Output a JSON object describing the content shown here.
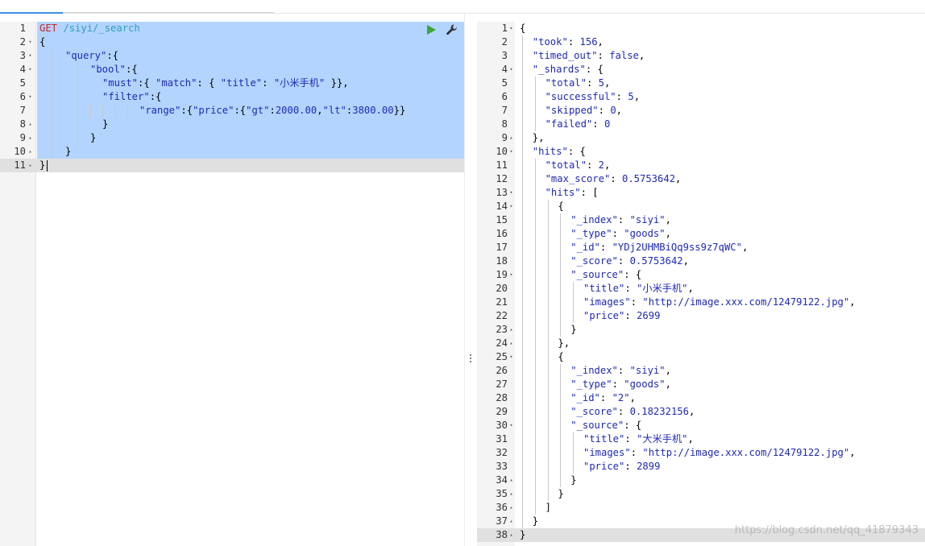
{
  "window": {
    "watermark": "https://blog.csdn.net/qq_41879343"
  },
  "request": {
    "method": "GET",
    "path": "/siyi/_search",
    "lines": [
      {
        "n": "1",
        "fold": ""
      },
      {
        "n": "2",
        "fold": "▾"
      },
      {
        "n": "3",
        "fold": "▾"
      },
      {
        "n": "4",
        "fold": "▾"
      },
      {
        "n": "5",
        "fold": ""
      },
      {
        "n": "6",
        "fold": "▾"
      },
      {
        "n": "7",
        "fold": ""
      },
      {
        "n": "8",
        "fold": "▴"
      },
      {
        "n": "9",
        "fold": "▴"
      },
      {
        "n": "10",
        "fold": "▴"
      },
      {
        "n": "11",
        "fold": "▴"
      }
    ],
    "tokens": {
      "l2": "{",
      "l3_key": "\"query\"",
      "l3_rest": ":{",
      "l4_key": "\"bool\"",
      "l4_rest": ":{",
      "l5_key": "\"must\"",
      "l5_a": ":{ ",
      "l5_match": "\"match\"",
      "l5_b": ": { ",
      "l5_title": "\"title\"",
      "l5_c": ": ",
      "l5_val": "\"小米手机\"",
      "l5_d": " }},",
      "l6_key": "\"filter\"",
      "l6_rest": ":{",
      "l7_key": "\"range\"",
      "l7_a": ":{",
      "l7_price": "\"price\"",
      "l7_b": ":{",
      "l7_gt": "\"gt\"",
      "l7_c": ":",
      "l7_gtv": "2000.00",
      "l7_d": ",",
      "l7_lt": "\"lt\"",
      "l7_e": ":",
      "l7_ltv": "3800.00",
      "l7_f": "}}",
      "l8": "}",
      "l9": "}",
      "l10": "}",
      "l11": "}"
    },
    "actions": {
      "run": "play-icon",
      "settings": "wrench-icon"
    }
  },
  "response": {
    "lines": [
      {
        "n": "1",
        "fold": "▾"
      },
      {
        "n": "2",
        "fold": ""
      },
      {
        "n": "3",
        "fold": ""
      },
      {
        "n": "4",
        "fold": "▾"
      },
      {
        "n": "5",
        "fold": ""
      },
      {
        "n": "6",
        "fold": ""
      },
      {
        "n": "7",
        "fold": ""
      },
      {
        "n": "8",
        "fold": ""
      },
      {
        "n": "9",
        "fold": "▴"
      },
      {
        "n": "10",
        "fold": "▾"
      },
      {
        "n": "11",
        "fold": ""
      },
      {
        "n": "12",
        "fold": ""
      },
      {
        "n": "13",
        "fold": "▾"
      },
      {
        "n": "14",
        "fold": "▾"
      },
      {
        "n": "15",
        "fold": ""
      },
      {
        "n": "16",
        "fold": ""
      },
      {
        "n": "17",
        "fold": ""
      },
      {
        "n": "18",
        "fold": ""
      },
      {
        "n": "19",
        "fold": "▾"
      },
      {
        "n": "20",
        "fold": ""
      },
      {
        "n": "21",
        "fold": ""
      },
      {
        "n": "22",
        "fold": ""
      },
      {
        "n": "23",
        "fold": "▴"
      },
      {
        "n": "24",
        "fold": "▴"
      },
      {
        "n": "25",
        "fold": "▾"
      },
      {
        "n": "26",
        "fold": ""
      },
      {
        "n": "27",
        "fold": ""
      },
      {
        "n": "28",
        "fold": ""
      },
      {
        "n": "29",
        "fold": ""
      },
      {
        "n": "30",
        "fold": "▾"
      },
      {
        "n": "31",
        "fold": ""
      },
      {
        "n": "32",
        "fold": ""
      },
      {
        "n": "33",
        "fold": ""
      },
      {
        "n": "34",
        "fold": "▴"
      },
      {
        "n": "35",
        "fold": "▴"
      },
      {
        "n": "36",
        "fold": "▴"
      },
      {
        "n": "37",
        "fold": "▴"
      },
      {
        "n": "38",
        "fold": "▴"
      }
    ],
    "code": [
      [
        {
          "t": "p",
          "v": "{"
        }
      ],
      [
        {
          "t": "k",
          "v": "\"took\""
        },
        {
          "t": "p",
          "v": ": "
        },
        {
          "t": "num",
          "v": "156"
        },
        {
          "t": "p",
          "v": ","
        }
      ],
      [
        {
          "t": "k",
          "v": "\"timed_out\""
        },
        {
          "t": "p",
          "v": ": "
        },
        {
          "t": "kw",
          "v": "false"
        },
        {
          "t": "p",
          "v": ","
        }
      ],
      [
        {
          "t": "k",
          "v": "\"_shards\""
        },
        {
          "t": "p",
          "v": ": {"
        }
      ],
      [
        {
          "t": "k",
          "v": "\"total\""
        },
        {
          "t": "p",
          "v": ": "
        },
        {
          "t": "num",
          "v": "5"
        },
        {
          "t": "p",
          "v": ","
        }
      ],
      [
        {
          "t": "k",
          "v": "\"successful\""
        },
        {
          "t": "p",
          "v": ": "
        },
        {
          "t": "num",
          "v": "5"
        },
        {
          "t": "p",
          "v": ","
        }
      ],
      [
        {
          "t": "k",
          "v": "\"skipped\""
        },
        {
          "t": "p",
          "v": ": "
        },
        {
          "t": "num",
          "v": "0"
        },
        {
          "t": "p",
          "v": ","
        }
      ],
      [
        {
          "t": "k",
          "v": "\"failed\""
        },
        {
          "t": "p",
          "v": ": "
        },
        {
          "t": "num",
          "v": "0"
        }
      ],
      [
        {
          "t": "p",
          "v": "},"
        }
      ],
      [
        {
          "t": "k",
          "v": "\"hits\""
        },
        {
          "t": "p",
          "v": ": {"
        }
      ],
      [
        {
          "t": "k",
          "v": "\"total\""
        },
        {
          "t": "p",
          "v": ": "
        },
        {
          "t": "num",
          "v": "2"
        },
        {
          "t": "p",
          "v": ","
        }
      ],
      [
        {
          "t": "k",
          "v": "\"max_score\""
        },
        {
          "t": "p",
          "v": ": "
        },
        {
          "t": "num",
          "v": "0.5753642"
        },
        {
          "t": "p",
          "v": ","
        }
      ],
      [
        {
          "t": "k",
          "v": "\"hits\""
        },
        {
          "t": "p",
          "v": ": ["
        }
      ],
      [
        {
          "t": "p",
          "v": "{"
        }
      ],
      [
        {
          "t": "k",
          "v": "\"_index\""
        },
        {
          "t": "p",
          "v": ": "
        },
        {
          "t": "s",
          "v": "\"siyi\""
        },
        {
          "t": "p",
          "v": ","
        }
      ],
      [
        {
          "t": "k",
          "v": "\"_type\""
        },
        {
          "t": "p",
          "v": ": "
        },
        {
          "t": "s",
          "v": "\"goods\""
        },
        {
          "t": "p",
          "v": ","
        }
      ],
      [
        {
          "t": "k",
          "v": "\"_id\""
        },
        {
          "t": "p",
          "v": ": "
        },
        {
          "t": "s",
          "v": "\"YDj2UHMBiQq9ss9z7qWC\""
        },
        {
          "t": "p",
          "v": ","
        }
      ],
      [
        {
          "t": "k",
          "v": "\"_score\""
        },
        {
          "t": "p",
          "v": ": "
        },
        {
          "t": "num",
          "v": "0.5753642"
        },
        {
          "t": "p",
          "v": ","
        }
      ],
      [
        {
          "t": "k",
          "v": "\"_source\""
        },
        {
          "t": "p",
          "v": ": {"
        }
      ],
      [
        {
          "t": "k",
          "v": "\"title\""
        },
        {
          "t": "p",
          "v": ": "
        },
        {
          "t": "s",
          "v": "\"小米手机\""
        },
        {
          "t": "p",
          "v": ","
        }
      ],
      [
        {
          "t": "k",
          "v": "\"images\""
        },
        {
          "t": "p",
          "v": ": "
        },
        {
          "t": "s",
          "v": "\"http://image.xxx.com/12479122.jpg\""
        },
        {
          "t": "p",
          "v": ","
        }
      ],
      [
        {
          "t": "k",
          "v": "\"price\""
        },
        {
          "t": "p",
          "v": ": "
        },
        {
          "t": "num",
          "v": "2699"
        }
      ],
      [
        {
          "t": "p",
          "v": "}"
        }
      ],
      [
        {
          "t": "p",
          "v": "},"
        }
      ],
      [
        {
          "t": "p",
          "v": "{"
        }
      ],
      [
        {
          "t": "k",
          "v": "\"_index\""
        },
        {
          "t": "p",
          "v": ": "
        },
        {
          "t": "s",
          "v": "\"siyi\""
        },
        {
          "t": "p",
          "v": ","
        }
      ],
      [
        {
          "t": "k",
          "v": "\"_type\""
        },
        {
          "t": "p",
          "v": ": "
        },
        {
          "t": "s",
          "v": "\"goods\""
        },
        {
          "t": "p",
          "v": ","
        }
      ],
      [
        {
          "t": "k",
          "v": "\"_id\""
        },
        {
          "t": "p",
          "v": ": "
        },
        {
          "t": "s",
          "v": "\"2\""
        },
        {
          "t": "p",
          "v": ","
        }
      ],
      [
        {
          "t": "k",
          "v": "\"_score\""
        },
        {
          "t": "p",
          "v": ": "
        },
        {
          "t": "num",
          "v": "0.18232156"
        },
        {
          "t": "p",
          "v": ","
        }
      ],
      [
        {
          "t": "k",
          "v": "\"_source\""
        },
        {
          "t": "p",
          "v": ": {"
        }
      ],
      [
        {
          "t": "k",
          "v": "\"title\""
        },
        {
          "t": "p",
          "v": ": "
        },
        {
          "t": "s",
          "v": "\"大米手机\""
        },
        {
          "t": "p",
          "v": ","
        }
      ],
      [
        {
          "t": "k",
          "v": "\"images\""
        },
        {
          "t": "p",
          "v": ": "
        },
        {
          "t": "s",
          "v": "\"http://image.xxx.com/12479122.jpg\""
        },
        {
          "t": "p",
          "v": ","
        }
      ],
      [
        {
          "t": "k",
          "v": "\"price\""
        },
        {
          "t": "p",
          "v": ": "
        },
        {
          "t": "num",
          "v": "2899"
        }
      ],
      [
        {
          "t": "p",
          "v": "}"
        }
      ],
      [
        {
          "t": "p",
          "v": "}"
        }
      ],
      [
        {
          "t": "p",
          "v": "]"
        }
      ],
      [
        {
          "t": "p",
          "v": "}"
        }
      ],
      [
        {
          "t": "p",
          "v": "}"
        }
      ]
    ]
  },
  "colors": {
    "selection": "#b2d4ff",
    "active_line": "#e0e0e0",
    "method": "#c8252a",
    "url": "#2f9fbf",
    "json_value": "#1f2ab3",
    "run_icon": "#3aa63a"
  }
}
